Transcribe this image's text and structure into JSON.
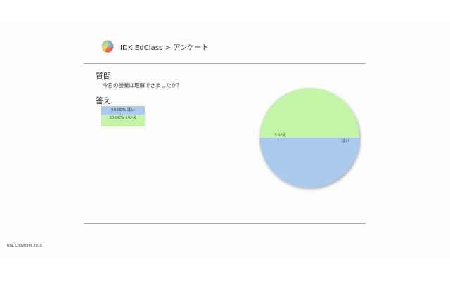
{
  "header": {
    "title": "IDK EdClass > アンケート",
    "logo_icon": "pie-chart-logo-icon"
  },
  "question": {
    "heading": "質問",
    "text": "今日の授業は理解できましたか？"
  },
  "answers": {
    "heading": "答え",
    "items": [
      {
        "label": "50.00% はい",
        "color": "#abcbed"
      },
      {
        "label": "50.00% いいえ",
        "color": "#c2f5a6"
      }
    ]
  },
  "chart_data": {
    "type": "pie",
    "categories": [
      "はい",
      "いいえ"
    ],
    "values": [
      50,
      50
    ],
    "colors": [
      "#abcbed",
      "#c2f5a6"
    ],
    "legend_position": "left"
  },
  "footer": {
    "copyright": "NSL Copyright 2016"
  }
}
